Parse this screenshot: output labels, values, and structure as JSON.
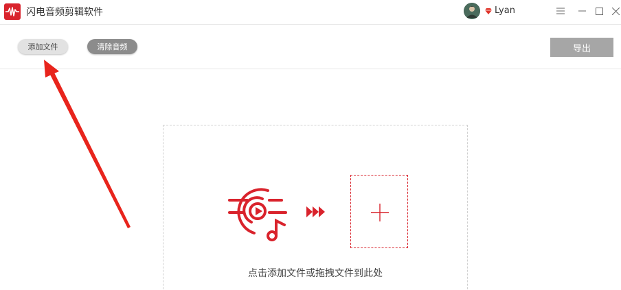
{
  "titlebar": {
    "app_title": "闪电音频剪辑软件",
    "username": "Lyan",
    "icons": [
      "waveform-logo-icon",
      "avatar",
      "vip-diamond-icon",
      "menu-icon",
      "minimize-icon",
      "maximize-icon",
      "close-icon"
    ]
  },
  "toolbar": {
    "add_file_label": "添加文件",
    "clear_audio_label": "清除音频",
    "export_label": "导出"
  },
  "dropzone": {
    "hint": "点击添加文件或拖拽文件到此处",
    "icons": [
      "media-video-music-icon",
      "triple-arrow-icon",
      "plus-icon"
    ]
  },
  "colors": {
    "accent": "#d9232c",
    "export_disabled": "#a6a6a6",
    "clear_button": "#8c8c8c",
    "add_button": "#e2e2e2",
    "annotation_arrow": "#e8241c"
  }
}
